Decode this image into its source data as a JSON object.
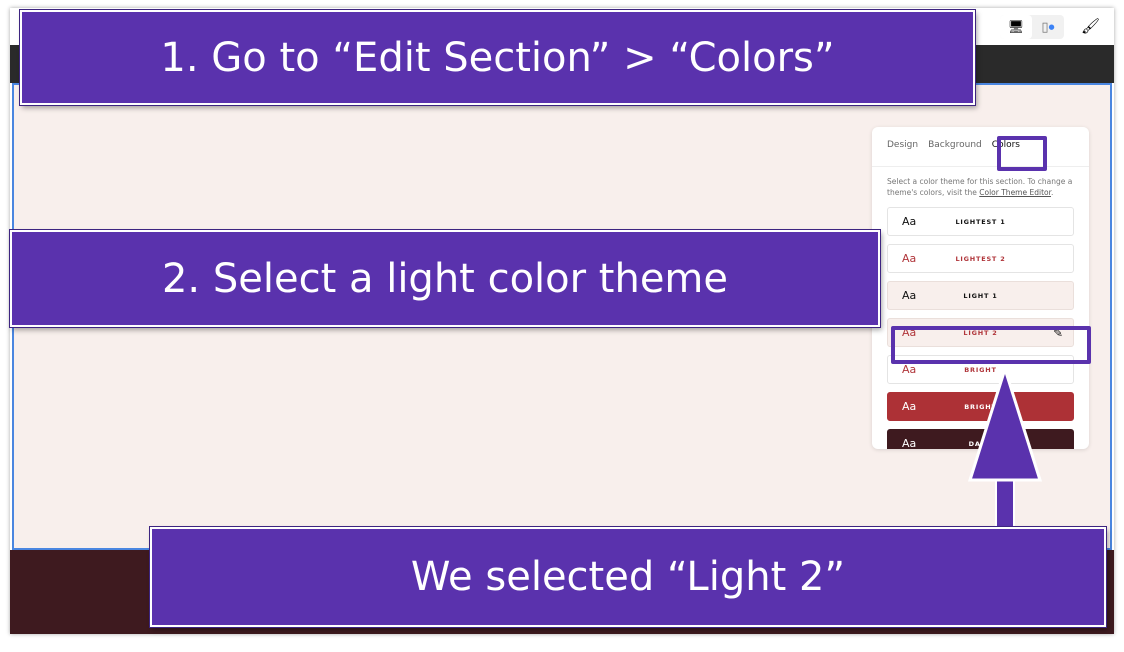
{
  "callouts": {
    "step1": "1. Go to “Edit Section” > “Colors”",
    "step2": "2. Select a light color theme",
    "result": "We selected “Light 2”"
  },
  "toolbar": {
    "desktop_icon": "desktop-icon",
    "mobile_icon": "mobile-icon",
    "brush_icon": "paintbrush-icon"
  },
  "panel": {
    "tabs": [
      "Design",
      "Background",
      "Colors"
    ],
    "active_tab": "Colors",
    "description": "Select a color theme for this section. To change a theme's colors, visit the ",
    "editor_link": "Color Theme Editor",
    "themes": [
      {
        "aa": "Aa",
        "name": "LIGHTEST 1",
        "bg": "#ffffff",
        "fg": "#111111"
      },
      {
        "aa": "Aa",
        "name": "LIGHTEST 2",
        "bg": "#ffffff",
        "fg": "#b0353a"
      },
      {
        "aa": "Aa",
        "name": "LIGHT 1",
        "bg": "#f8efec",
        "fg": "#111111"
      },
      {
        "aa": "Aa",
        "name": "LIGHT 2",
        "bg": "#f8efec",
        "fg": "#b0353a"
      },
      {
        "aa": "Aa",
        "name": "BRIGHT",
        "bg": "#ffffff",
        "fg": "#b0353a"
      },
      {
        "aa": "Aa",
        "name": "BRIGHT",
        "bg": "#ad3136",
        "fg": "#ffffff"
      },
      {
        "aa": "Aa",
        "name": "DARK",
        "bg": "#3e1a1f",
        "fg": "#ffffff"
      }
    ],
    "selected_theme": "LIGHT 2"
  },
  "colors": {
    "accent": "#5a32ad",
    "section_bg": "#f8efec",
    "footer_bg": "#3e1a1f",
    "selection_border": "#4a86e0"
  }
}
